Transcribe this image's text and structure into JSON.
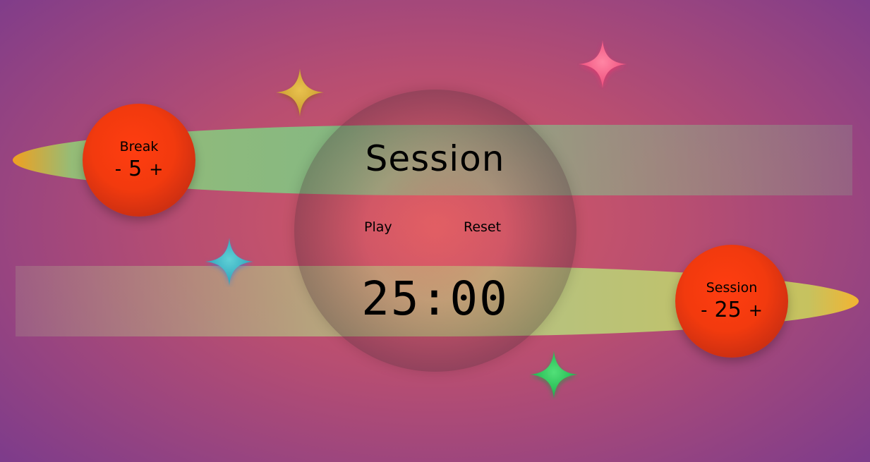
{
  "title": "Session",
  "controls": {
    "play": "Play",
    "reset": "Reset"
  },
  "timer": "25:00",
  "break": {
    "label": "Break",
    "decrement": "-",
    "value": "5",
    "increment": "+"
  },
  "session": {
    "label": "Session",
    "decrement": "-",
    "value": "25",
    "increment": "+"
  },
  "colors": {
    "planet": "#f23a0e",
    "sparkle_gold": "#d6ac3a",
    "sparkle_pink": "#f25f86",
    "sparkle_cyan": "#38b6c6",
    "sparkle_green": "#1fcc5a"
  },
  "icons": {
    "decorations": [
      "sparkle-icon",
      "sparkle-icon",
      "sparkle-icon",
      "sparkle-icon"
    ]
  }
}
